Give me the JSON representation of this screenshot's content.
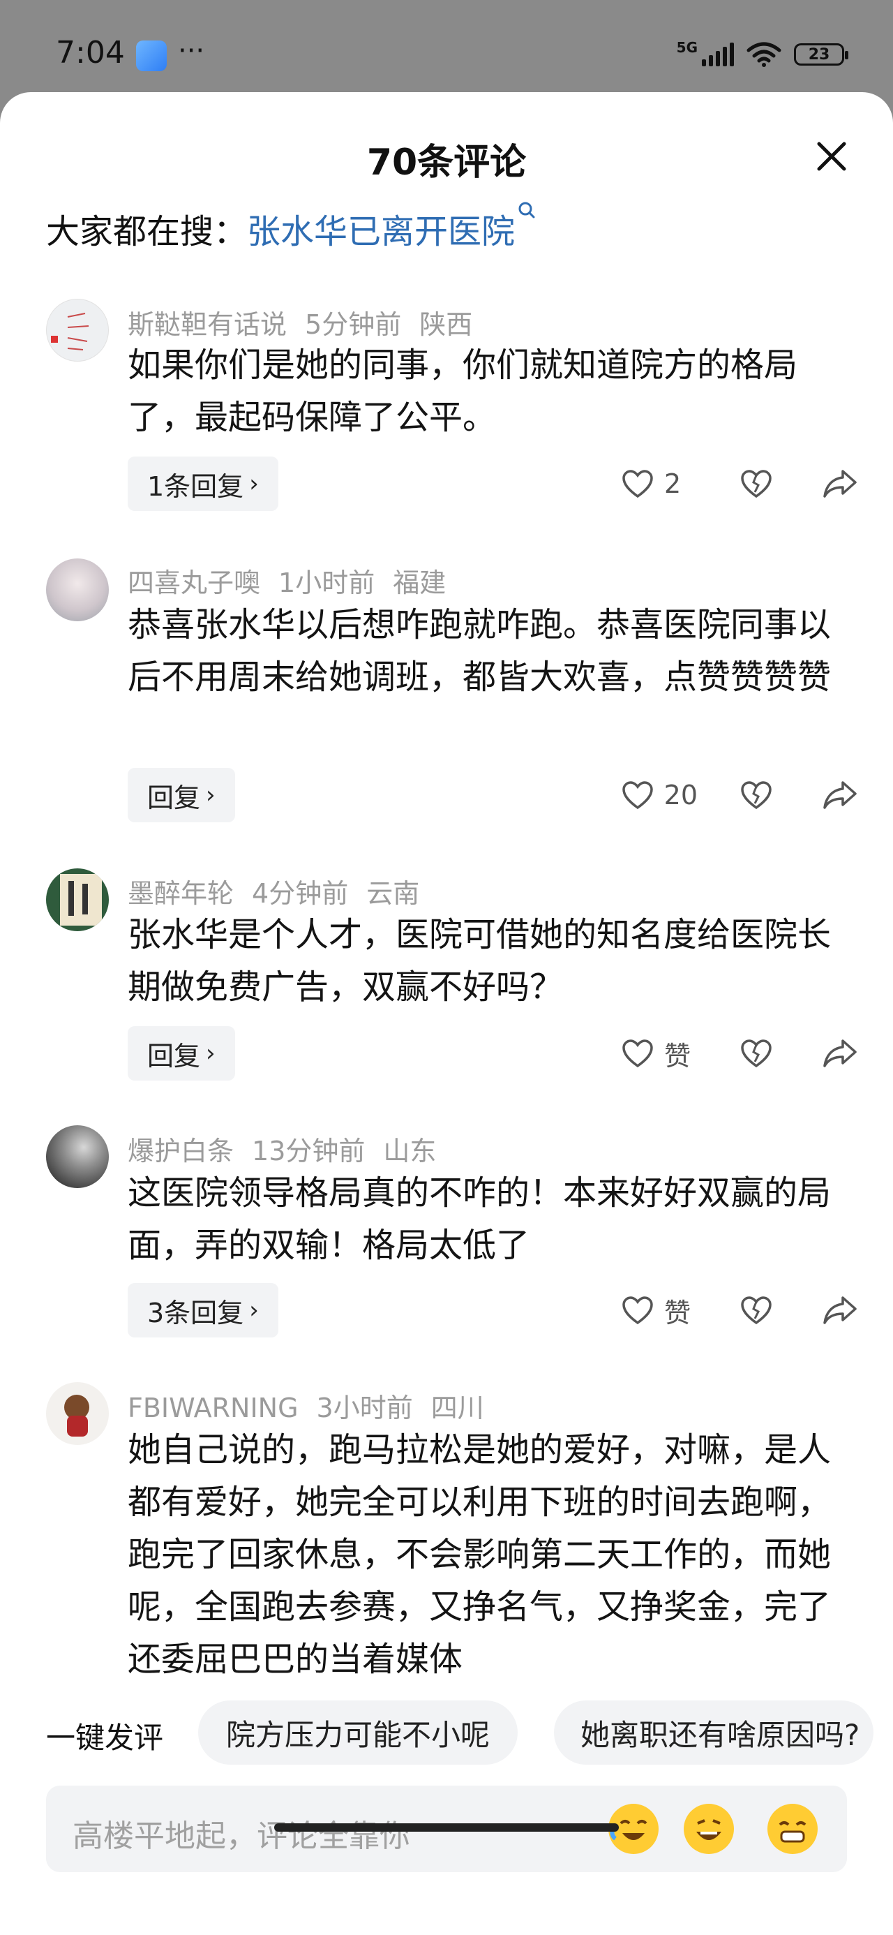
{
  "status_bar": {
    "time": "7:04",
    "dots": "···",
    "network": "5G",
    "battery": "23"
  },
  "sheet": {
    "title": "70条评论",
    "hot_search_prefix": "大家都在搜：",
    "hot_search_link": "张水华已离开医院"
  },
  "comments": [
    {
      "user": "斯鞑靼有话说",
      "time": "5分钟前",
      "location": "陕西",
      "text": "如果你们是她的同事，你们就知道院方的格局了，最起码保障了公平。",
      "reply": "1条回复",
      "likes": "2"
    },
    {
      "user": "四喜丸子噢",
      "time": "1小时前",
      "location": "福建",
      "text": "恭喜张水华以后想咋跑就咋跑。恭喜医院同事以后不用周末给她调班，都皆大欢喜，点赞赞赞赞",
      "reply": "回复",
      "likes": "20"
    },
    {
      "user": "墨醉年轮",
      "time": "4分钟前",
      "location": "云南",
      "text": "张水华是个人才，医院可借她的知名度给医院长期做免费广告，双赢不好吗？",
      "reply": "回复",
      "likes": "赞"
    },
    {
      "user": "爆护白条",
      "time": "13分钟前",
      "location": "山东",
      "text": "这医院领导格局真的不咋的！本来好好双赢的局面，弄的双输！格局太低了",
      "reply": "3条回复",
      "likes": "赞"
    },
    {
      "user": "FBIWARNING",
      "time": "3小时前",
      "location": "四川",
      "text": "她自己说的，跑马拉松是她的爱好，对嘛，是人都有爱好，她完全可以利用下班的时间去跑啊，跑完了回家休息，不会影响第二天工作的，而她呢，全国跑去参赛，又挣名气，又挣奖金，完了还委屈巴巴的当着媒体"
    }
  ],
  "quick_comment": {
    "label": "一键发评",
    "chips": [
      "院方压力可能不小呢",
      "她离职还有啥原因吗?"
    ]
  },
  "input": {
    "placeholder": "高楼平地起，评论全靠你"
  },
  "icons": [
    "close-icon",
    "search-icon",
    "heart-icon",
    "broken-heart-icon",
    "share-icon",
    "chevron-right-icon"
  ],
  "colors": {
    "link": "#2f6db3",
    "meta": "#9b9b9b",
    "chip_bg": "#f2f3f5"
  }
}
